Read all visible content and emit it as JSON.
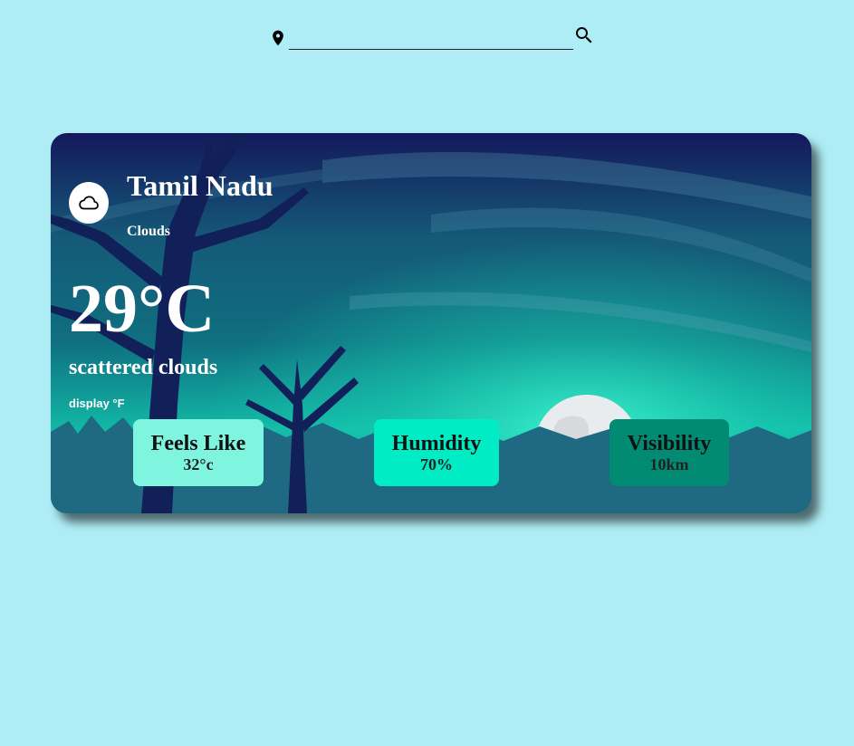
{
  "search": {
    "value": "",
    "placeholder": "",
    "location_icon": "location-pin-icon",
    "search_icon": "magnifier-icon"
  },
  "weather": {
    "icon": "cloud-icon",
    "city": "Tamil Nadu",
    "condition": "Clouds",
    "temperature": "29°C",
    "description": "scattered clouds",
    "unit_toggle_label": "display °F"
  },
  "stats": [
    {
      "label": "Feels Like",
      "value": "32°c",
      "color": "#7ff5df"
    },
    {
      "label": "Humidity",
      "value": "70%",
      "color": "#00ecc5"
    },
    {
      "label": "Visibility",
      "value": "10km",
      "color": "#008b72"
    }
  ],
  "colors": {
    "page_background": "#aeedf5",
    "sky_top": "#14195c",
    "sky_mid": "#0e5c74",
    "glow": "#1fe8c0",
    "ground": "#1f6a82",
    "tree": "#12205a",
    "moon": "#e9ecef"
  }
}
